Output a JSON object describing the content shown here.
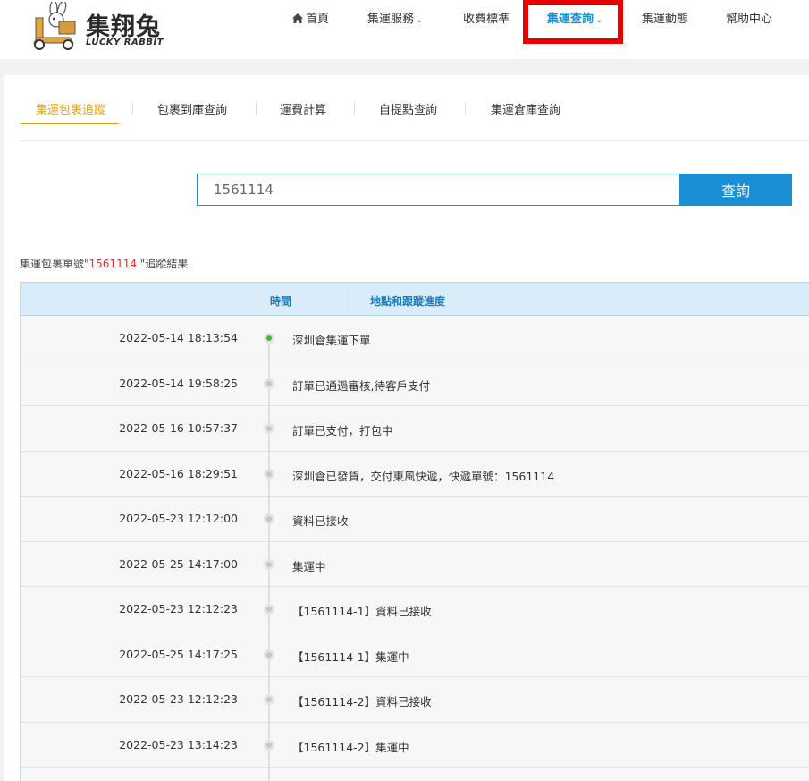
{
  "logo": {
    "title": "集翔兔",
    "subtitle": "LUCKY RABBIT"
  },
  "nav": {
    "home": "首頁",
    "service": "集運服務",
    "pricing": "收費標準",
    "query": "集運查詢",
    "news": "集運動態",
    "help": "幫助中心"
  },
  "tabs": [
    "集運包裹追蹤",
    "包裹到庫查詢",
    "運費計算",
    "自提點查詢",
    "集運倉庫查詢"
  ],
  "search": {
    "value": "1561114",
    "button": "查詢"
  },
  "result": {
    "prefix": "集運包裹單號\"",
    "number": "1561114",
    "suffix": " \"追蹤結果"
  },
  "table": {
    "col_time": "時間",
    "col_progress": "地點和跟蹤進度",
    "rows": [
      {
        "time": "2022-05-14 18:13:54",
        "desc": "深圳倉集運下單"
      },
      {
        "time": "2022-05-14 19:58:25",
        "desc": "訂單已通過審核,待客戶支付"
      },
      {
        "time": "2022-05-16 10:57:37",
        "desc": "訂單已支付，打包中"
      },
      {
        "time": "2022-05-16 18:29:51",
        "desc": "深圳倉已發貨，交付東風快遞，快遞單號：1561114"
      },
      {
        "time": "2022-05-23 12:12:00",
        "desc": "資料已接收"
      },
      {
        "time": "2022-05-25 14:17:00",
        "desc": "集運中"
      },
      {
        "time": "2022-05-23 12:12:23",
        "desc": "【1561114-1】資料已接收"
      },
      {
        "time": "2022-05-25 14:17:25",
        "desc": "【1561114-1】集運中"
      },
      {
        "time": "2022-05-23 12:12:23",
        "desc": "【1561114-2】資料已接收"
      },
      {
        "time": "2022-05-23 13:14:23",
        "desc": "【1561114-2】集運中"
      },
      {
        "time": "",
        "desc": ""
      }
    ]
  },
  "colors": {
    "accent": "#1a8fd6",
    "tab_active": "#e0a31b",
    "highlight": "#e60000",
    "number": "#d9302c"
  }
}
